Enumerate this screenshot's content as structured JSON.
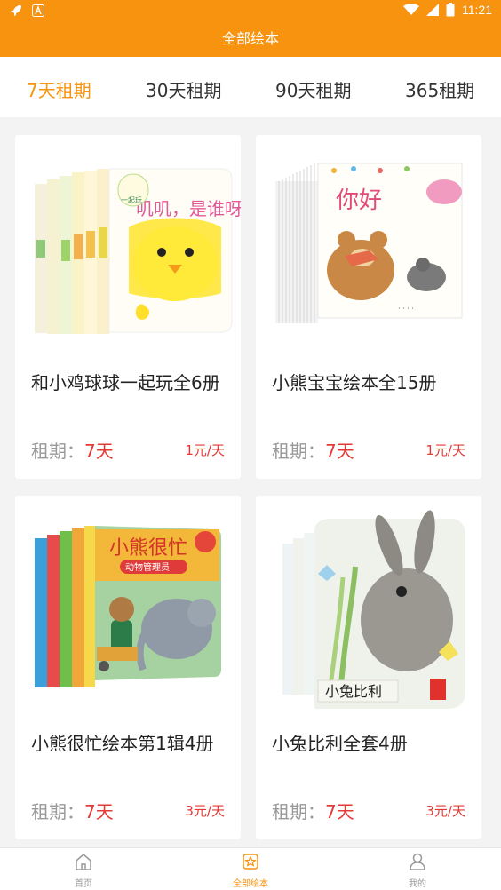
{
  "status_bar": {
    "time": "11:21"
  },
  "header": {
    "title": "全部绘本"
  },
  "tabs": [
    {
      "label": "7天租期",
      "active": true
    },
    {
      "label": "30天租期",
      "active": false
    },
    {
      "label": "90天租期",
      "active": false
    },
    {
      "label": "365租期",
      "active": false
    }
  ],
  "products": [
    {
      "title": "和小鸡球球一起玩全6册",
      "period_label": "租期：",
      "period_value": "7天",
      "price": "1元/天",
      "cover": {
        "text": "叽叽，是谁呀？",
        "badge": "一起玩"
      }
    },
    {
      "title": "小熊宝宝绘本全15册",
      "period_label": "租期：",
      "period_value": "7天",
      "price": "1元/天",
      "cover": {
        "text": "你好"
      }
    },
    {
      "title": "小熊很忙绘本第1辑4册",
      "period_label": "租期：",
      "period_value": "7天",
      "price": "3元/天",
      "cover": {
        "text": "小熊很忙",
        "subtext": "动物管理员"
      }
    },
    {
      "title": "小兔比利全套4册",
      "period_label": "租期：",
      "period_value": "7天",
      "price": "3元/天",
      "cover": {
        "text": "小兔比利"
      }
    }
  ],
  "bottom_nav": [
    {
      "label": "首页",
      "icon": "home-icon",
      "active": false
    },
    {
      "label": "全部绘本",
      "icon": "books-icon",
      "active": true
    },
    {
      "label": "我的",
      "icon": "user-icon",
      "active": false
    }
  ],
  "colors": {
    "accent": "#f7930e",
    "price": "#e53935"
  }
}
